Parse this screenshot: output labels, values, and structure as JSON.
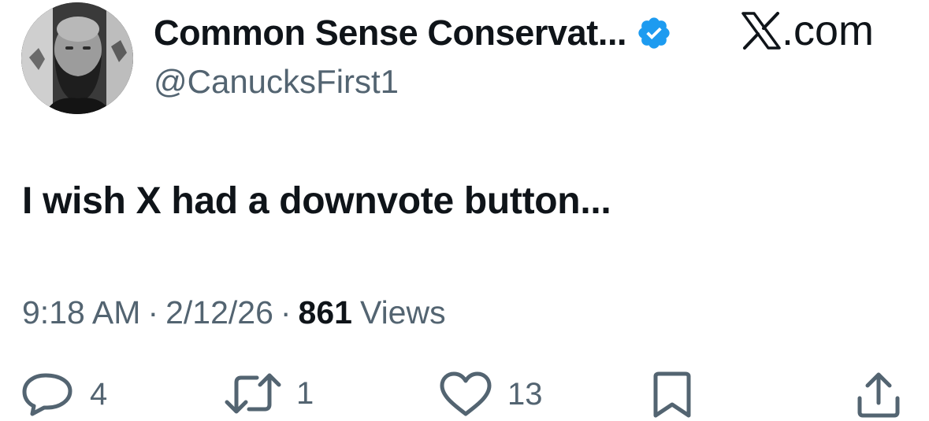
{
  "author": {
    "display_name": "Common Sense Conservat...",
    "handle": "@CanucksFirst1",
    "verified": true,
    "verified_color": "#1d9bf0"
  },
  "brand": {
    "text": ".com",
    "icon": "x-logo-icon"
  },
  "tweet": {
    "text": "I wish X had a downvote button..."
  },
  "meta": {
    "time": "9:18 AM",
    "separator": "·",
    "date": "2/12/26",
    "views_count": "861",
    "views_label": "Views"
  },
  "actions": {
    "reply": {
      "icon": "reply-icon",
      "count": "4"
    },
    "retweet": {
      "icon": "retweet-icon",
      "count": "1"
    },
    "like": {
      "icon": "heart-icon",
      "count": "13"
    },
    "bookmark": {
      "icon": "bookmark-icon"
    },
    "share": {
      "icon": "share-icon"
    }
  },
  "colors": {
    "primary_text": "#0f1419",
    "secondary_text": "#536471",
    "accent": "#1d9bf0"
  }
}
